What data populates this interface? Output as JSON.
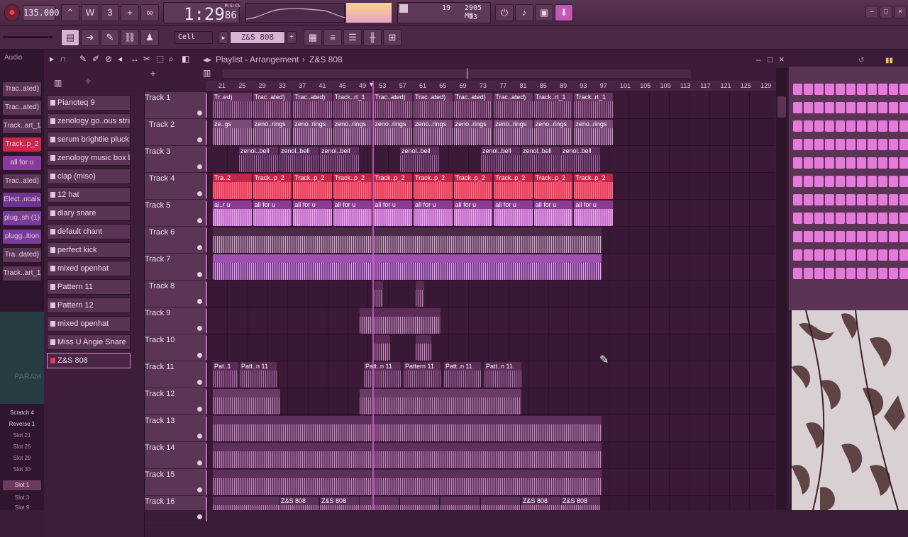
{
  "toolbar": {
    "tempo": "135.000",
    "time": "1:29",
    "time_ticks": "86",
    "time_unit": "M:S:CS",
    "cpu_value": "19",
    "memory": "2905 MB",
    "polyphony": "33"
  },
  "toolbar2": {
    "snap": "Cell",
    "pattern": "Z&S 808"
  },
  "playlist": {
    "title": "Playlist - Arrangement",
    "current_pattern": "Z&S 808"
  },
  "browser": {
    "tab": "Audio",
    "tracks": [
      "Trac..ated)",
      "Trac..ated)",
      "Track..art_1",
      "Track..p_2",
      "all for u",
      "Trac..ated)",
      "Elect..ocals",
      "plug..sh (1)",
      "plugg..ition",
      "Tra..dated)",
      "Track..art_1"
    ],
    "slots": [
      "Scratch 4",
      "Reverse 1",
      "Slot 21",
      "Slot 25",
      "Slot 29",
      "Slot 33",
      "Slot 1",
      "Slot 3",
      "Slot 9"
    ],
    "param_label": "PARAM"
  },
  "channels": [
    "Pianoteq 9",
    "zenology go..ous strings",
    "serum brightlie pluck",
    "zenology music box bell",
    "clap (miso)",
    "12 hat",
    "diary snare",
    "default chant",
    "perfect kick",
    "mixed openhat",
    "Pattern 11",
    "Pattern 12",
    "mixed openhat",
    "Miss U Angie Snare",
    "Z&S 808"
  ],
  "ruler": [
    "21",
    "25",
    "29",
    "33",
    "37",
    "41",
    "45",
    "49",
    "53",
    "57",
    "61",
    "65",
    "69",
    "73",
    "77",
    "81",
    "85",
    "89",
    "93",
    "97",
    "101",
    "105",
    "109",
    "113",
    "117",
    "121",
    "125",
    "129"
  ],
  "tracks": [
    "Track 1",
    "Track 2",
    "Track 3",
    "Track 4",
    "Track 5",
    "Track 6",
    "Track 7",
    "Track 8",
    "Track 9",
    "Track 10",
    "Track 11",
    "Track 12",
    "Track 13",
    "Track 14",
    "Track 15",
    "Track 16"
  ],
  "clip_labels": {
    "t1": "Trac..ated)",
    "t1_first": "Tr..ed)",
    "t1_alt": "Track..rt_1",
    "t2": "zeno..rings",
    "t2_first": "ze..gs",
    "t3": "zenol..bell",
    "t4": "Track..p_2",
    "t4_first": "Tra..2",
    "t5": "all for u",
    "t5_first": "al..r u",
    "t11": "Patt..n 11",
    "t11_first": "Pat..1",
    "t11_alt": "Pattern 11",
    "t16": "Z&S 808"
  },
  "colors": {
    "accent": "#e47ad9",
    "red_clip": "#e8405c",
    "bg": "#3a1a36"
  }
}
